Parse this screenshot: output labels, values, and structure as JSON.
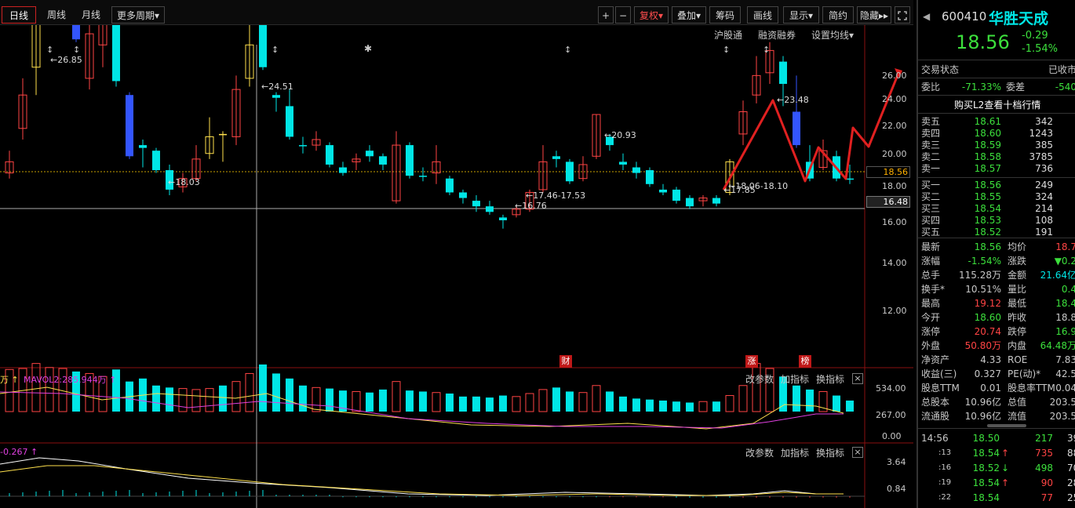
{
  "toolbar": {
    "day": "日线",
    "week": "周线",
    "month": "月线",
    "more_period": "更多周期",
    "more_period_arrow": "▾",
    "plus": "+",
    "minus": "−",
    "fq": "复权",
    "fq_arrow": "▾",
    "overlay": "叠加",
    "overlay_arrow": "▾",
    "chips": "筹码",
    "draw": "画线",
    "display": "显示",
    "display_arrow": "▾",
    "simple": "简约",
    "hide": "隐藏",
    "hide_arrow": "▸▸"
  },
  "chart_header": {
    "hgt": "沪股通",
    "margin": "融资融券",
    "ma_settings": "设置均线",
    "ma_settings_arrow": "▾"
  },
  "price_axis": [
    "26.00",
    "24.00",
    "22.00",
    "20.00",
    "18.00",
    "16.00",
    "14.00",
    "12.00"
  ],
  "price_current_tag": "18.56",
  "price_cross_tag": "16.48",
  "annotations": {
    "high1": "26.85",
    "high2": "24.51",
    "low1": "18.03",
    "mid1": "20.93",
    "low2": "16.76",
    "range1": "17.46-17.53",
    "high3": "23.48",
    "low3": "17.85",
    "range2": "18.06-18.10"
  },
  "event_marks": {
    "cai": "财",
    "zhang": "涨",
    "bang": "榜"
  },
  "volume_panel": {
    "label_left": "万",
    "label_ma2": "MAVOL2:285.944万",
    "params": "改参数",
    "add": "加指标",
    "switch": "换指标",
    "close": "×",
    "axis": [
      "534.00",
      "267.00",
      "0.00"
    ]
  },
  "macd_panel": {
    "label": "-0.267",
    "params": "改参数",
    "add": "加指标",
    "switch": "换指标",
    "close": "×",
    "axis": [
      "3.64",
      "0.84"
    ]
  },
  "quote": {
    "back_arrow": "◀",
    "code": "600410",
    "name": "华胜天成",
    "price": "18.56",
    "change": "-0.29",
    "change_pct": "-1.54%",
    "trade_status_label": "交易状态",
    "trade_status": "已收市",
    "weibi_label": "委比",
    "weibi": "-71.33%",
    "weicha_label": "委差",
    "weicha": "-540",
    "l2_link": "购买L2查看十档行情",
    "sell": [
      {
        "label": "卖五",
        "price": "18.61",
        "vol": "342"
      },
      {
        "label": "卖四",
        "price": "18.60",
        "vol": "1243"
      },
      {
        "label": "卖三",
        "price": "18.59",
        "vol": "385"
      },
      {
        "label": "卖二",
        "price": "18.58",
        "vol": "3785"
      },
      {
        "label": "卖一",
        "price": "18.57",
        "vol": "736"
      }
    ],
    "buy": [
      {
        "label": "买一",
        "price": "18.56",
        "vol": "249"
      },
      {
        "label": "买二",
        "price": "18.55",
        "vol": "324"
      },
      {
        "label": "买三",
        "price": "18.54",
        "vol": "214"
      },
      {
        "label": "买四",
        "price": "18.53",
        "vol": "108"
      },
      {
        "label": "买五",
        "price": "18.52",
        "vol": "191"
      }
    ],
    "stats": [
      {
        "l1": "最新",
        "v1": "18.56",
        "c1": "down",
        "l2": "均价",
        "v2": "18.7",
        "c2": "up"
      },
      {
        "l1": "涨幅",
        "v1": "-1.54%",
        "c1": "down",
        "l2": "涨跌",
        "v2": "▼0.2",
        "c2": "down"
      },
      {
        "l1": "总手",
        "v1": "115.28万",
        "c1": "flat",
        "l2": "金额",
        "v2": "21.64亿",
        "c2": "cyan"
      },
      {
        "l1": "换手*",
        "v1": "10.51%",
        "c1": "flat",
        "l2": "量比",
        "v2": "0.4",
        "c2": "down"
      },
      {
        "l1": "最高",
        "v1": "19.12",
        "c1": "up",
        "l2": "最低",
        "v2": "18.4",
        "c2": "down"
      },
      {
        "l1": "今开",
        "v1": "18.60",
        "c1": "down",
        "l2": "昨收",
        "v2": "18.8",
        "c2": "flat"
      },
      {
        "l1": "涨停",
        "v1": "20.74",
        "c1": "up",
        "l2": "跌停",
        "v2": "16.9",
        "c2": "down"
      },
      {
        "l1": "外盘",
        "v1": "50.80万",
        "c1": "up",
        "l2": "内盘",
        "v2": "64.48万",
        "c2": "down"
      },
      {
        "l1": "净资产",
        "v1": "4.33",
        "c1": "flat",
        "l2": "ROE",
        "v2": "7.83",
        "c2": "flat"
      },
      {
        "l1": "收益(三)",
        "v1": "0.327",
        "c1": "flat",
        "l2": "PE(动)*",
        "v2": "42.5",
        "c2": "flat"
      },
      {
        "l1": "股息TTM",
        "v1": "0.01",
        "c1": "flat",
        "l2": "股息率TTM",
        "v2": "0.04",
        "c2": "flat"
      },
      {
        "l1": "总股本",
        "v1": "10.96亿",
        "c1": "flat",
        "l2": "总值",
        "v2": "203.5",
        "c2": "flat"
      },
      {
        "l1": "流通股",
        "v1": "10.96亿",
        "c1": "flat",
        "l2": "流值",
        "v2": "203.5",
        "c2": "flat"
      }
    ],
    "ticks": [
      {
        "time": "14:56",
        "price": "18.50",
        "pc": "down",
        "arrow": "",
        "ac": "",
        "vol": "217",
        "vc": "down",
        "n": "39"
      },
      {
        "time": ":13",
        "price": "18.54",
        "pc": "down",
        "arrow": "↑",
        "ac": "up",
        "vol": "735",
        "vc": "up",
        "n": "88"
      },
      {
        "time": ":16",
        "price": "18.52",
        "pc": "down",
        "arrow": "↓",
        "ac": "down",
        "vol": "498",
        "vc": "down",
        "n": "70"
      },
      {
        "time": ":19",
        "price": "18.54",
        "pc": "down",
        "arrow": "↑",
        "ac": "up",
        "vol": "90",
        "vc": "up",
        "n": "28"
      },
      {
        "time": ":22",
        "price": "18.54",
        "pc": "down",
        "arrow": "",
        "ac": "",
        "vol": "77",
        "vc": "up",
        "n": "25"
      }
    ]
  },
  "colors": {
    "up": "#ff4444",
    "down": "#3ce03c",
    "cyan": "#00e6e6",
    "yellow": "#ffe14d",
    "magenta": "#e040e0",
    "blue": "#3355ff",
    "arrow": "#e02020"
  }
}
